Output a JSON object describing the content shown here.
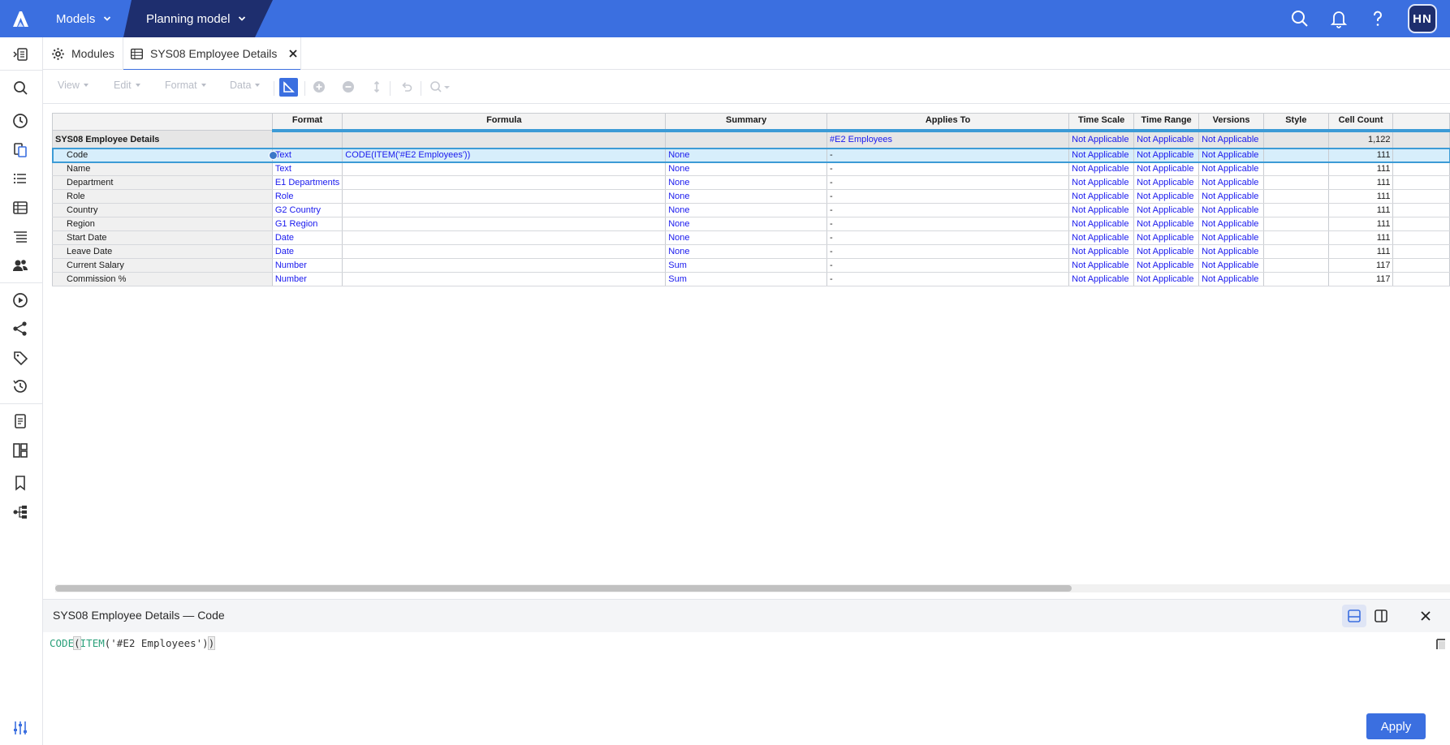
{
  "topbar": {
    "models_label": "Models",
    "planning_model_label": "Planning model",
    "avatar_initials": "HN",
    "icons": [
      "search-icon",
      "bell-icon",
      "help-icon"
    ]
  },
  "tabs": [
    {
      "label": "Modules",
      "icon": "gear-icon"
    },
    {
      "label": "SYS08 Employee Details",
      "icon": "table-icon",
      "active": true
    }
  ],
  "toolbar": {
    "view_label": "View",
    "edit_label": "Edit",
    "format_label": "Format",
    "data_label": "Data"
  },
  "grid": {
    "columns": [
      "Format",
      "Formula",
      "Summary",
      "Applies To",
      "Time Scale",
      "Time Range",
      "Versions",
      "Style",
      "Cell Count"
    ],
    "module_row": {
      "name": "SYS08 Employee Details",
      "format": "",
      "formula": "",
      "summary": "",
      "applies_to": "#E2 Employees",
      "time_scale": "Not Applicable",
      "time_range": "Not Applicable",
      "versions": "Not Applicable",
      "style": "",
      "cell_count": "1,122"
    },
    "rows": [
      {
        "name": "Code",
        "format": "Text",
        "formula": "CODE(ITEM('#E2 Employees'))",
        "summary": "None",
        "applies_to": "-",
        "time_scale": "Not Applicable",
        "time_range": "Not Applicable",
        "versions": "Not Applicable",
        "style": "",
        "cell_count": "111"
      },
      {
        "name": "Name",
        "format": "Text",
        "formula": "",
        "summary": "None",
        "applies_to": "-",
        "time_scale": "Not Applicable",
        "time_range": "Not Applicable",
        "versions": "Not Applicable",
        "style": "",
        "cell_count": "111"
      },
      {
        "name": "Department",
        "format": "E1 Departments",
        "formula": "",
        "summary": "None",
        "applies_to": "-",
        "time_scale": "Not Applicable",
        "time_range": "Not Applicable",
        "versions": "Not Applicable",
        "style": "",
        "cell_count": "111"
      },
      {
        "name": "Role",
        "format": "Role",
        "formula": "",
        "summary": "None",
        "applies_to": "-",
        "time_scale": "Not Applicable",
        "time_range": "Not Applicable",
        "versions": "Not Applicable",
        "style": "",
        "cell_count": "111"
      },
      {
        "name": "Country",
        "format": "G2 Country",
        "formula": "",
        "summary": "None",
        "applies_to": "-",
        "time_scale": "Not Applicable",
        "time_range": "Not Applicable",
        "versions": "Not Applicable",
        "style": "",
        "cell_count": "111"
      },
      {
        "name": "Region",
        "format": "G1 Region",
        "formula": "",
        "summary": "None",
        "applies_to": "-",
        "time_scale": "Not Applicable",
        "time_range": "Not Applicable",
        "versions": "Not Applicable",
        "style": "",
        "cell_count": "111"
      },
      {
        "name": "Start Date",
        "format": "Date",
        "formula": "",
        "summary": "None",
        "applies_to": "-",
        "time_scale": "Not Applicable",
        "time_range": "Not Applicable",
        "versions": "Not Applicable",
        "style": "",
        "cell_count": "111"
      },
      {
        "name": "Leave Date",
        "format": "Date",
        "formula": "",
        "summary": "None",
        "applies_to": "-",
        "time_scale": "Not Applicable",
        "time_range": "Not Applicable",
        "versions": "Not Applicable",
        "style": "",
        "cell_count": "111"
      },
      {
        "name": "Current Salary",
        "format": "Number",
        "formula": "",
        "summary": "Sum",
        "applies_to": "-",
        "time_scale": "Not Applicable",
        "time_range": "Not Applicable",
        "versions": "Not Applicable",
        "style": "",
        "cell_count": "117"
      },
      {
        "name": "Commission %",
        "format": "Number",
        "formula": "",
        "summary": "Sum",
        "applies_to": "-",
        "time_scale": "Not Applicable",
        "time_range": "Not Applicable",
        "versions": "Not Applicable",
        "style": "",
        "cell_count": "117"
      }
    ]
  },
  "formula_panel": {
    "title": "SYS08 Employee Details — Code",
    "formula_fn1": "CODE",
    "formula_fn2": "ITEM",
    "formula_arg": "'#E2 Employees'",
    "apply_label": "Apply"
  },
  "colors": {
    "topbar": "#3b6fe0",
    "planning_model_bg": "#1e2e6e",
    "link_text": "#1a1aee",
    "header_accent": "#3c9bd6",
    "selected_row": "#d7eefb"
  }
}
